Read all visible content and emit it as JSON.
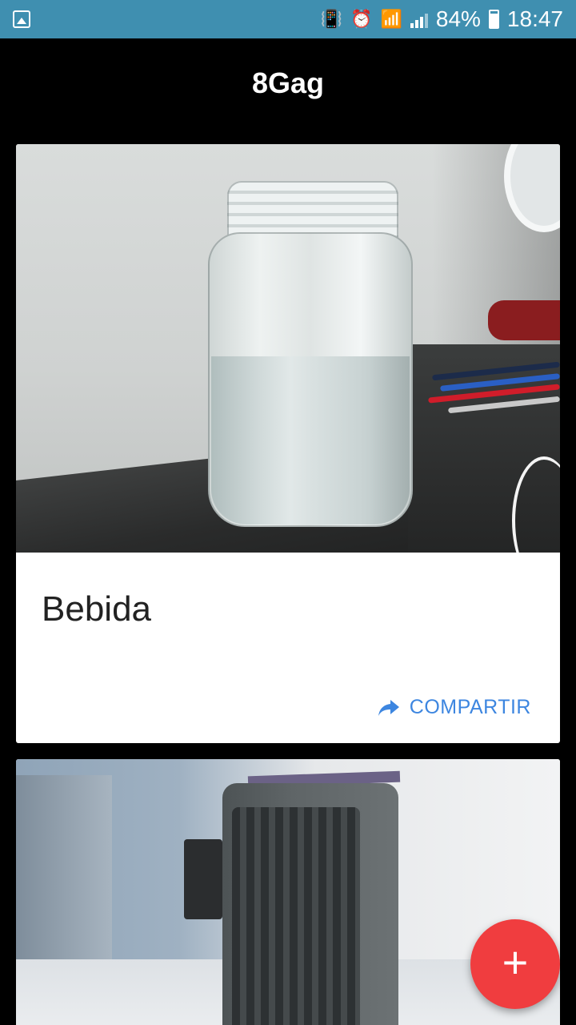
{
  "status_bar": {
    "battery_percent": "84%",
    "time": "18:47",
    "icons": [
      "gallery-icon",
      "vibrate-icon",
      "alarm-icon",
      "wifi-icon",
      "signal-icon",
      "battery-icon"
    ]
  },
  "app_bar": {
    "title": "8Gag"
  },
  "feed": {
    "posts": [
      {
        "title": "Bebida",
        "share_label": "COMPARTIR",
        "image": "photo of a glass jar with water on a table"
      },
      {
        "image": "photo of a portable air cooler"
      }
    ]
  },
  "fab": {
    "icon": "plus-icon",
    "label": "+"
  },
  "colors": {
    "status_bar": "#3f8fb0",
    "app_bar": "#000000",
    "accent": "#3d86e0",
    "fab": "#f03d3f"
  }
}
